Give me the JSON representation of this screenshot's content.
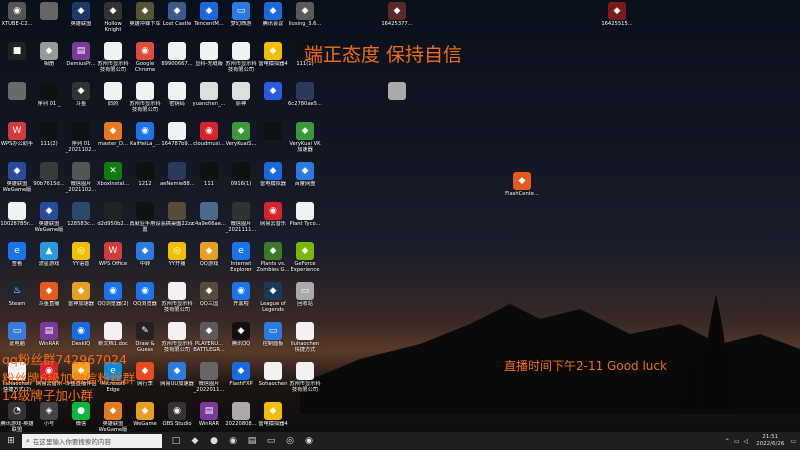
{
  "desktop": {
    "slogan": "端正态度 保持自信",
    "live_time": "直播时间下午2-11 Good luck",
    "qq_lines": [
      "qq粉丝群742967024",
      "粉丝牌6级加微信粉丝群",
      "14级牌子加小群"
    ]
  },
  "icons": [
    {
      "label": "XTUBE-C2...",
      "glyph": "◉",
      "color": "#555"
    },
    {
      "label": "",
      "glyph": "■",
      "color": "#222"
    },
    {
      "label": "",
      "glyph": "",
      "color": "#6b6b6b"
    },
    {
      "label": "WPS办公助手",
      "glyph": "W",
      "color": "#d23b3b"
    },
    {
      "label": "英雄联盟WeGame版",
      "glyph": "◆",
      "color": "#2a4a9a"
    },
    {
      "label": "100287B5r...",
      "glyph": "",
      "color": "#f2f2f2"
    },
    {
      "label": "查看",
      "glyph": "e",
      "color": "#1a73e8"
    },
    {
      "label": "Steam",
      "glyph": "♨",
      "color": "#1b2838"
    },
    {
      "label": "此电脑",
      "glyph": "▭",
      "color": "#3a7bd5"
    },
    {
      "label": "liuhaochen 快捷方式(2)",
      "glyph": "",
      "color": "#f2f2f2"
    },
    {
      "label": "腾讯游戏-英雄联盟",
      "glyph": "◔",
      "color": "#333"
    },
    {
      "label": "16425377...",
      "glyph": "◆",
      "color": "#5a2a2a"
    },
    {
      "label": "16425515...",
      "glyph": "◆",
      "color": "#7a1a1a"
    },
    {
      "label": "",
      "glyph": "",
      "color": "#666"
    },
    {
      "label": "相册",
      "glyph": "◆",
      "color": "#999"
    },
    {
      "label": "序列 01 _",
      "glyph": "",
      "color": "#111"
    },
    {
      "label": "111(2)",
      "glyph": "",
      "color": "#111"
    },
    {
      "label": "90b7615d...",
      "glyph": "",
      "color": "#3a3a3a"
    },
    {
      "label": "英雄联盟WeGame版",
      "glyph": "◆",
      "color": "#2a4a9a"
    },
    {
      "label": "流星游戏",
      "glyph": "▲",
      "color": "#2a9adf"
    },
    {
      "label": "斗鱼直播",
      "glyph": "◆",
      "color": "#e65a1e"
    },
    {
      "label": "WinRAR",
      "glyph": "▤",
      "color": "#7a3a9a"
    },
    {
      "label": "网易云音乐",
      "glyph": "◉",
      "color": "#d8232a"
    },
    {
      "label": "小号",
      "glyph": "◈",
      "color": "#444"
    },
    {
      "label": "英雄联盟",
      "glyph": "◆",
      "color": "#1a3a6a"
    },
    {
      "label": "",
      "glyph": "",
      "color": "#aaa"
    },
    {
      "label": "DemiusPr...",
      "glyph": "▤",
      "color": "#7a3a9a"
    },
    {
      "label": "斗鱼",
      "glyph": "◆",
      "color": "#333"
    },
    {
      "label": "序列 01 _2021102...",
      "glyph": "",
      "color": "#111"
    },
    {
      "label": "微信图片_2021102...",
      "glyph": "",
      "color": "#555"
    },
    {
      "label": "128583c...",
      "glyph": "",
      "color": "#2a4a6a"
    },
    {
      "label": "YY语音",
      "glyph": "◎",
      "color": "#f0c000"
    },
    {
      "label": "雷神加速器",
      "glyph": "◆",
      "color": "#e6a020"
    },
    {
      "label": "DeskIQ",
      "glyph": "◉",
      "color": "#1a6adf"
    },
    {
      "label": "斗鱼直播伴侣",
      "glyph": "◆",
      "color": "#f5a01e"
    },
    {
      "label": "微信",
      "glyph": "●",
      "color": "#09b83e"
    },
    {
      "label": "Hollow Knight",
      "glyph": "◆",
      "color": "#333"
    },
    {
      "label": "苏州市显示科技有限公司",
      "glyph": "",
      "color": "#f2f2f2"
    },
    {
      "label": "旧的",
      "glyph": "",
      "color": "#f2f2f2"
    },
    {
      "label": "master_D...",
      "glyph": "◆",
      "color": "#e67a1e"
    },
    {
      "label": "XboxInstal...",
      "glyph": "✕",
      "color": "#107c10"
    },
    {
      "label": "d2d950b2...",
      "glyph": "",
      "color": "#222"
    },
    {
      "label": "WPS Office",
      "glyph": "W",
      "color": "#d23b3b"
    },
    {
      "label": "QQ浏览器(2)",
      "glyph": "◉",
      "color": "#1a73e8"
    },
    {
      "label": "新文档1.doc",
      "glyph": "",
      "color": "#f2f2f2"
    },
    {
      "label": "Microsoft Edge",
      "glyph": "e",
      "color": "#0c8ad7"
    },
    {
      "label": "英雄联盟WeGame版",
      "glyph": "◆",
      "color": "#e67a1e"
    },
    {
      "label": "英雄冲锋下车",
      "glyph": "◆",
      "color": "#553"
    },
    {
      "label": "Google Chrome",
      "glyph": "◉",
      "color": "#dd4b39"
    },
    {
      "label": "苏州市显示科技有限公司",
      "glyph": "",
      "color": "#f2f2f2"
    },
    {
      "label": "KaiHeiLa_...",
      "glyph": "◉",
      "color": "#1a73e8"
    },
    {
      "label": "1212",
      "glyph": "",
      "color": "#111"
    },
    {
      "label": "再就业手用设置",
      "glyph": "",
      "color": "#111"
    },
    {
      "label": "中转",
      "glyph": "◆",
      "color": "#2a7adf"
    },
    {
      "label": "QQ浏览器",
      "glyph": "◉",
      "color": "#1a73e8"
    },
    {
      "label": "Draw & Guess",
      "glyph": "✎",
      "color": "#222"
    },
    {
      "label": "网行李",
      "glyph": "◆",
      "color": "#e64a1e"
    },
    {
      "label": "WeGame",
      "glyph": "◆",
      "color": "#e6a020"
    },
    {
      "label": "Lost Castle",
      "glyph": "◆",
      "color": "#3a5a8a"
    },
    {
      "label": "89900667...",
      "glyph": "",
      "color": "#f2f2f2"
    },
    {
      "label": "密钥码",
      "glyph": "",
      "color": "#f2f2f2"
    },
    {
      "label": "164787b9...",
      "glyph": "",
      "color": "#f2f2f2"
    },
    {
      "label": "FlashCente...",
      "glyph": "◆",
      "color": "#e65a1e"
    },
    {
      "label": "aeNemie88...",
      "glyph": "",
      "color": "#2a3a5a"
    },
    {
      "label": "恶搞桌面22zz",
      "glyph": "",
      "color": "#5a4a3a"
    },
    {
      "label": "YY开播",
      "glyph": "◎",
      "color": "#f0c000"
    },
    {
      "label": "苏州市显示科技有限公司",
      "glyph": "",
      "color": "#f2f2f2"
    },
    {
      "label": "苏州市显示科技有限公司",
      "glyph": "",
      "color": "#f2f2f2"
    },
    {
      "label": "网易UU加速器",
      "glyph": "◆",
      "color": "#2a7adf"
    },
    {
      "label": "OBS Studio",
      "glyph": "◉",
      "color": "#333"
    },
    {
      "label": "TencentM...",
      "glyph": "◆",
      "color": "#1a6adf"
    },
    {
      "label": "显科-无缝版",
      "glyph": "",
      "color": "#f2f2f2"
    },
    {
      "label": "yuanchen_...",
      "glyph": "",
      "color": "#ddd"
    },
    {
      "label": "cloudmusi...",
      "glyph": "◉",
      "color": "#d8232a"
    },
    {
      "label": "111",
      "glyph": "",
      "color": "#111"
    },
    {
      "label": "c4a9e66ae...",
      "glyph": "",
      "color": "#4a6a8a"
    },
    {
      "label": "QQ游戏",
      "glyph": "◆",
      "color": "#e6a020"
    },
    {
      "label": "QQ三国",
      "glyph": "◆",
      "color": "#5a4a3a"
    },
    {
      "label": "PLAYERU... BATTLEGR...",
      "glyph": "◆",
      "color": "#5a5a5a"
    },
    {
      "label": "微信图片_2022011...",
      "glyph": "",
      "color": "#666"
    },
    {
      "label": "WinRAR",
      "glyph": "▤",
      "color": "#7a3a9a"
    },
    {
      "label": "梦幻西游",
      "glyph": "▭",
      "color": "#2a7adf"
    },
    {
      "label": "苏州市显示科技有限公司",
      "glyph": "",
      "color": "#f2f2f2"
    },
    {
      "label": "原神",
      "glyph": "",
      "color": "#ddd"
    },
    {
      "label": "VeryKuaiS...",
      "glyph": "◆",
      "color": "#3a9a3a"
    },
    {
      "label": "0916(1)",
      "glyph": "",
      "color": "#111"
    },
    {
      "label": "微信图片_2021111...",
      "glyph": "",
      "color": "#333"
    },
    {
      "label": "Internet Explorer",
      "glyph": "e",
      "color": "#1a73e8"
    },
    {
      "label": "开黑啦",
      "glyph": "◉",
      "color": "#1a73e8"
    },
    {
      "label": "腾讯QQ",
      "glyph": "◆",
      "color": "#111"
    },
    {
      "label": "FlashFXP",
      "glyph": "◆",
      "color": "#1a6adf"
    },
    {
      "label": "20220808...",
      "glyph": "",
      "color": "#aaa"
    },
    {
      "label": "腾讯会议",
      "glyph": "◆",
      "color": "#1a6adf"
    },
    {
      "label": "雷电模拟器4",
      "glyph": "◆",
      "color": "#f0c000"
    },
    {
      "label": "",
      "glyph": "◆",
      "color": "#2a5adf"
    },
    {
      "label": "",
      "glyph": "",
      "color": "#111"
    },
    {
      "label": "雷电模拟器",
      "glyph": "◆",
      "color": "#1a6adf"
    },
    {
      "label": "网易云音乐",
      "glyph": "◉",
      "color": "#d8232a"
    },
    {
      "label": "Plants vs. Zombies G...",
      "glyph": "◆",
      "color": "#3a7a2a"
    },
    {
      "label": "League of Legends",
      "glyph": "◆",
      "color": "#1a3a5a"
    },
    {
      "label": "控制面板",
      "glyph": "▭",
      "color": "#2a7adf"
    },
    {
      "label": "Sohaochen",
      "glyph": "",
      "color": "#f2f2f2"
    },
    {
      "label": "雷电模拟器4",
      "glyph": "◆",
      "color": "#f0c000"
    },
    {
      "label": "liusing_3.6...",
      "glyph": "◆",
      "color": "#5a5a5a"
    },
    {
      "label": "111(1)",
      "glyph": "",
      "color": "#111"
    },
    {
      "label": "6c2780ae5...",
      "glyph": "",
      "color": "#2a3a5a"
    },
    {
      "label": "VeryKuai VK加速器",
      "glyph": "◆",
      "color": "#3a9a3a"
    },
    {
      "label": "百度网盘",
      "glyph": "◆",
      "color": "#2a7adf"
    },
    {
      "label": "Plant Tyco...",
      "glyph": "",
      "color": "#f2f2f2"
    },
    {
      "label": "GeForce Experience",
      "glyph": "◆",
      "color": "#76b900"
    },
    {
      "label": "回收站",
      "glyph": "▭",
      "color": "#aaa"
    },
    {
      "label": "liuhaochen 快捷方式",
      "glyph": "",
      "color": "#f2f2f2"
    },
    {
      "label": "苏州市显示科技有限公司",
      "glyph": "",
      "color": "#f2f2f2"
    }
  ],
  "taskbar": {
    "search_placeholder": "在这里输入你要搜索的内容",
    "time": "21:51",
    "date": "2022/6/26",
    "pinned": [
      "□",
      "◆",
      "●",
      "◉",
      "▤",
      "▭",
      "◎",
      "◉"
    ]
  }
}
